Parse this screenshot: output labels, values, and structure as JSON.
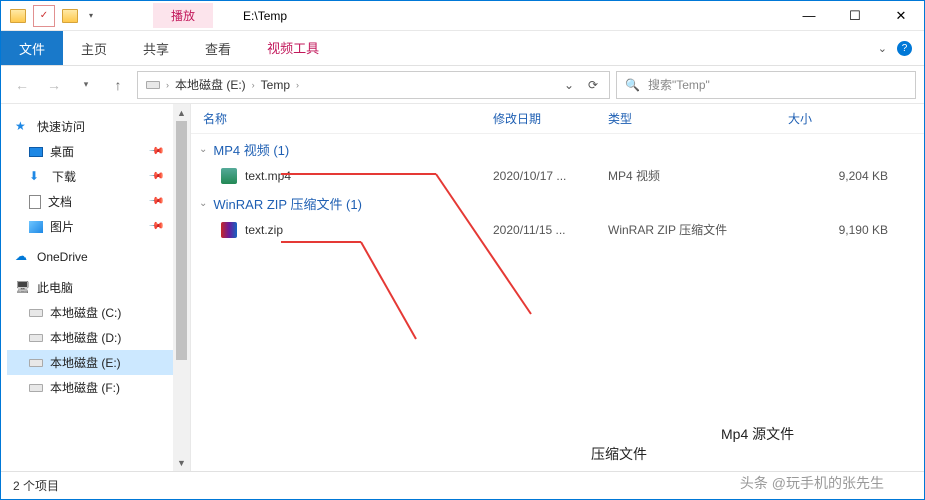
{
  "titlebar": {
    "play_tab": "播放",
    "title": "E:\\Temp"
  },
  "window_controls": {
    "min": "—",
    "max": "☐",
    "close": "✕"
  },
  "ribbon": {
    "file": "文件",
    "home": "主页",
    "share": "共享",
    "view": "查看",
    "video_tools": "视频工具"
  },
  "nav": {
    "breadcrumb": [
      "本地磁盘 (E:)",
      "Temp"
    ],
    "search_placeholder": "搜索\"Temp\""
  },
  "sidebar": {
    "quick_access": "快速访问",
    "desktop": "桌面",
    "downloads": "下载",
    "documents": "文档",
    "pictures": "图片",
    "onedrive": "OneDrive",
    "this_pc": "此电脑",
    "drive_c": "本地磁盘 (C:)",
    "drive_d": "本地磁盘 (D:)",
    "drive_e": "本地磁盘 (E:)",
    "drive_f": "本地磁盘 (F:)"
  },
  "columns": {
    "name": "名称",
    "date": "修改日期",
    "type": "类型",
    "size": "大小"
  },
  "groups": [
    {
      "header": "MP4 视频 (1)",
      "rows": [
        {
          "name": "text.mp4",
          "date": "2020/10/17 ...",
          "type": "MP4 视频",
          "size": "9,204 KB",
          "icon": "mp4"
        }
      ]
    },
    {
      "header": "WinRAR ZIP 压缩文件 (1)",
      "rows": [
        {
          "name": "text.zip",
          "date": "2020/11/15 ...",
          "type": "WinRAR ZIP 压缩文件",
          "size": "9,190 KB",
          "icon": "zip"
        }
      ]
    }
  ],
  "annotations": {
    "source_file": "Mp4 源文件",
    "compressed_file": "压缩文件"
  },
  "status": {
    "item_count": "2 个项目"
  },
  "watermark": "头条 @玩手机的张先生"
}
